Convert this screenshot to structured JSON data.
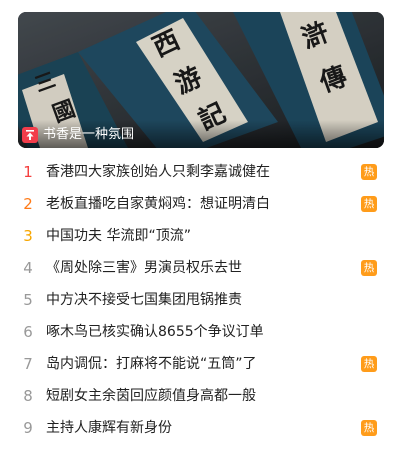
{
  "banner": {
    "title": "书香是一种氛围",
    "badge_icon": "pin-top-icon",
    "badge_color": "#f23d4b"
  },
  "hot_list": {
    "hot_label": "热",
    "rank_colors": [
      "#f5403f",
      "#ff7a17",
      "#f7a600"
    ],
    "items": [
      {
        "rank": "1",
        "title": "香港四大家族创始人只剩李嘉诚健在",
        "hot": true
      },
      {
        "rank": "2",
        "title": "老板直播吃自家黄焖鸡：想证明清白",
        "hot": true
      },
      {
        "rank": "3",
        "title": "中国功夫 华流即“顶流”",
        "hot": false
      },
      {
        "rank": "4",
        "title": "《周处除三害》男演员权乐去世",
        "hot": true
      },
      {
        "rank": "5",
        "title": "中方决不接受七国集团甩锅推责",
        "hot": false
      },
      {
        "rank": "6",
        "title": "啄木鸟已核实确认8655个争议订单",
        "hot": false
      },
      {
        "rank": "7",
        "title": "岛内调侃：打麻将不能说“五筒”了",
        "hot": true
      },
      {
        "rank": "8",
        "title": "短剧女主余茵回应颜值身高都一般",
        "hot": false
      },
      {
        "rank": "9",
        "title": "主持人康辉有新身份",
        "hot": true
      }
    ]
  }
}
